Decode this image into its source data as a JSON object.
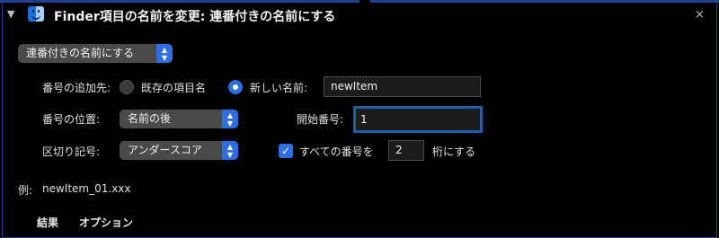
{
  "header": {
    "title": "Finder項目の名前を変更: 連番付きの名前にする",
    "disclosure_icon": "▼",
    "close_icon": "×"
  },
  "mode_popup": {
    "selected": "連番付きの名前にする"
  },
  "numbering": {
    "add_label": "番号の追加先:",
    "option_existing": "既存の項目名",
    "option_new": "新しい名前:",
    "new_name_value": "newItem",
    "position_label": "番号の位置:",
    "position_selected": "名前の後",
    "start_label": "開始番号:",
    "start_value": "1",
    "separator_label": "区切り記号:",
    "separator_selected": "アンダースコア",
    "digits_checkbox_label": "すべての番号を",
    "digits_value": "2",
    "digits_suffix": "桁にする"
  },
  "example": {
    "label": "例:",
    "value": "newItem_01.xxx"
  },
  "tabs": [
    "結果",
    "オプション"
  ],
  "colors": {
    "accent": "#2d6fe0",
    "focus_ring": "#1d5fa8",
    "border": "#1f3f8f"
  }
}
